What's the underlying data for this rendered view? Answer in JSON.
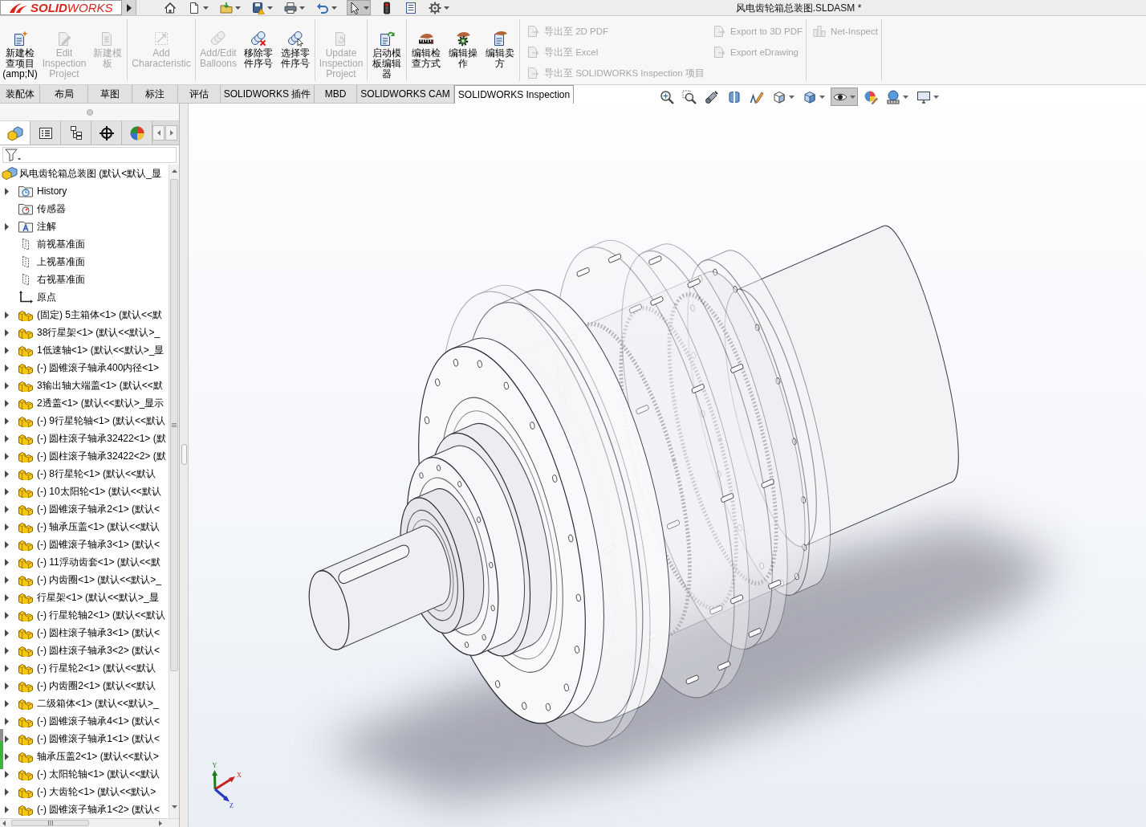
{
  "title_bar": {
    "logo": "**SOLID**WORKS",
    "title": "风电齿轮箱总装图.SLDASM *"
  },
  "quick_access_toolbar": {
    "buttons": [
      {
        "selected": false,
        "dropdown": false
      },
      {
        "selected": false,
        "dropdown": true
      },
      {
        "selected": false,
        "dropdown": true
      },
      {
        "selected": false,
        "dropdown": true
      },
      {
        "selected": false,
        "dropdown": true
      },
      {
        "selected": false,
        "dropdown": true
      },
      {
        "selected": true,
        "dropdown": true
      },
      {
        "selected": false,
        "dropdown": false
      },
      {
        "selected": false,
        "dropdown": false
      },
      {
        "selected": false,
        "dropdown": true
      }
    ]
  },
  "ribbon": {
    "groups": [
      {
        "kind": "large",
        "buttons": [
          {
            "label": "新建检查项目(amp;N)",
            "disabled": false
          },
          {
            "label": "Edit Inspection Project",
            "disabled": true
          },
          {
            "label": "新建模板",
            "disabled": true
          }
        ]
      },
      {
        "kind": "large",
        "buttons": [
          {
            "label": "Add Characteristic",
            "disabled": true
          }
        ]
      },
      {
        "kind": "large",
        "buttons": [
          {
            "label": "Add/Edit Balloons",
            "disabled": true
          },
          {
            "label": "移除零件序号",
            "disabled": false
          },
          {
            "label": "选择零件序号",
            "disabled": false
          }
        ]
      },
      {
        "kind": "large",
        "buttons": [
          {
            "label": "Update Inspection Project",
            "disabled": true
          }
        ]
      },
      {
        "kind": "large",
        "buttons": [
          {
            "label": "启动模板编辑器",
            "disabled": false
          }
        ]
      },
      {
        "kind": "large",
        "buttons": [
          {
            "label": "编辑检查方式",
            "disabled": false
          },
          {
            "label": "编辑操作",
            "disabled": false
          },
          {
            "label": "编辑卖方",
            "disabled": false
          }
        ]
      },
      {
        "kind": "small",
        "columns": [
          [
            {
              "label": "导出至 2D PDF",
              "disabled": true
            },
            {
              "label": "导出至 Excel",
              "disabled": true
            },
            {
              "label": "导出至 SOLIDWORKS Inspection 项目",
              "disabled": true
            }
          ],
          [
            {
              "label": "Export to 3D PDF",
              "disabled": true
            },
            {
              "label": "Export eDrawing",
              "disabled": true
            }
          ]
        ]
      },
      {
        "kind": "small",
        "columns": [
          [
            {
              "label": "Net-Inspect",
              "disabled": true
            }
          ]
        ]
      }
    ]
  },
  "command_tabs": [
    {
      "label": "装配体",
      "selected": false
    },
    {
      "label": "布局",
      "selected": false
    },
    {
      "label": "草图",
      "selected": false
    },
    {
      "label": "标注",
      "selected": false
    },
    {
      "label": "评估",
      "selected": false
    },
    {
      "label": "SOLIDWORKS 插件",
      "selected": false
    },
    {
      "label": "MBD",
      "selected": false
    },
    {
      "label": "SOLIDWORKS CAM",
      "selected": false
    },
    {
      "label": "SOLIDWORKS Inspection",
      "selected": true
    }
  ],
  "view_toolbar": {
    "buttons": [
      {
        "selected": false,
        "dropdown": false
      },
      {
        "selected": false,
        "dropdown": false
      },
      {
        "selected": false,
        "dropdown": false
      },
      {
        "selected": false,
        "dropdown": false
      },
      {
        "selected": false,
        "dropdown": false
      },
      {
        "selected": false,
        "dropdown": true
      },
      {
        "selected": false,
        "dropdown": true
      },
      {
        "selected": true,
        "dropdown": true
      },
      {
        "selected": false,
        "dropdown": false
      },
      {
        "selected": false,
        "dropdown": true
      },
      {
        "selected": false,
        "dropdown": true
      }
    ]
  },
  "feature_manager": {
    "tabs": [
      {
        "selected": true
      },
      {
        "selected": false
      },
      {
        "selected": false
      },
      {
        "selected": false
      },
      {
        "selected": false
      }
    ],
    "tree": {
      "label": "风电齿轮箱总装图 (默认<默认_显",
      "kind": "assembly",
      "children": [
        {
          "label": "History",
          "kind": "history",
          "expandable": true
        },
        {
          "label": "传感器",
          "kind": "sensors",
          "expandable": false
        },
        {
          "label": "注解",
          "kind": "annotations",
          "expandable": true
        },
        {
          "label": "前视基准面",
          "kind": "plane",
          "expandable": false
        },
        {
          "label": "上视基准面",
          "kind": "plane",
          "expandable": false
        },
        {
          "label": "右视基准面",
          "kind": "plane",
          "expandable": false
        },
        {
          "label": "原点",
          "kind": "origin",
          "expandable": false
        },
        {
          "label": "(固定) 5主箱体<1> (默认<<默",
          "kind": "part",
          "expandable": true
        },
        {
          "label": "38行星架<1> (默认<<默认>_",
          "kind": "part",
          "expandable": true
        },
        {
          "label": "1低速轴<1> (默认<<默认>_显",
          "kind": "part",
          "expandable": true
        },
        {
          "label": "(-) 圆锥滚子轴承400内径<1>",
          "kind": "part",
          "expandable": true
        },
        {
          "label": "3输出轴大端盖<1> (默认<<默",
          "kind": "part",
          "expandable": true
        },
        {
          "label": "2透盖<1> (默认<<默认>_显示",
          "kind": "part",
          "expandable": true
        },
        {
          "label": "(-) 9行星轮轴<1> (默认<<默认",
          "kind": "part",
          "expandable": true
        },
        {
          "label": "(-) 圆柱滚子轴承32422<1> (默",
          "kind": "part",
          "expandable": true
        },
        {
          "label": "(-) 圆柱滚子轴承32422<2> (默",
          "kind": "part",
          "expandable": true
        },
        {
          "label": "(-) 8行星轮<1> (默认<<默认",
          "kind": "part",
          "expandable": true
        },
        {
          "label": "(-) 10太阳轮<1> (默认<<默认",
          "kind": "part",
          "expandable": true
        },
        {
          "label": "(-) 圆锥滚子轴承2<1> (默认<",
          "kind": "part",
          "expandable": true
        },
        {
          "label": "(-) 轴承压盖<1> (默认<<默认",
          "kind": "part",
          "expandable": true
        },
        {
          "label": "(-) 圆锥滚子轴承3<1> (默认<",
          "kind": "part",
          "expandable": true
        },
        {
          "label": "(-) 11浮动齿套<1> (默认<<默",
          "kind": "part",
          "expandable": true
        },
        {
          "label": "(-) 内齿圈<1> (默认<<默认>_",
          "kind": "part",
          "expandable": true
        },
        {
          "label": "行星架<1> (默认<<默认>_显",
          "kind": "part",
          "expandable": true
        },
        {
          "label": "(-) 行星轮轴2<1> (默认<<默认",
          "kind": "part",
          "expandable": true
        },
        {
          "label": "(-) 圆柱滚子轴承3<1> (默认<",
          "kind": "part",
          "expandable": true
        },
        {
          "label": "(-) 圆柱滚子轴承3<2> (默认<",
          "kind": "part",
          "expandable": true
        },
        {
          "label": "(-) 行星轮2<1> (默认<<默认",
          "kind": "part",
          "expandable": true
        },
        {
          "label": "(-) 内齿圈2<1> (默认<<默认",
          "kind": "part",
          "expandable": true
        },
        {
          "label": "二级箱体<1> (默认<<默认>_",
          "kind": "part",
          "expandable": true
        },
        {
          "label": "(-) 圆锥滚子轴承4<1> (默认<",
          "kind": "part",
          "expandable": true
        },
        {
          "label": "(-) 圆锥滚子轴承1<1> (默认<",
          "kind": "part",
          "expandable": true
        },
        {
          "label": "轴承压盖2<1> (默认<<默认>",
          "kind": "part",
          "expandable": true
        },
        {
          "label": "(-) 太阳轮轴<1> (默认<<默认",
          "kind": "part",
          "expandable": true
        },
        {
          "label": "(-) 大齿轮<1> (默认<<默认>",
          "kind": "part",
          "expandable": true
        },
        {
          "label": "(-) 圆锥滚子轴承1<2> (默认<",
          "kind": "part",
          "expandable": true
        }
      ]
    }
  },
  "graphics": {
    "triad": {
      "x": "X",
      "y": "Y",
      "z": "Z"
    }
  }
}
